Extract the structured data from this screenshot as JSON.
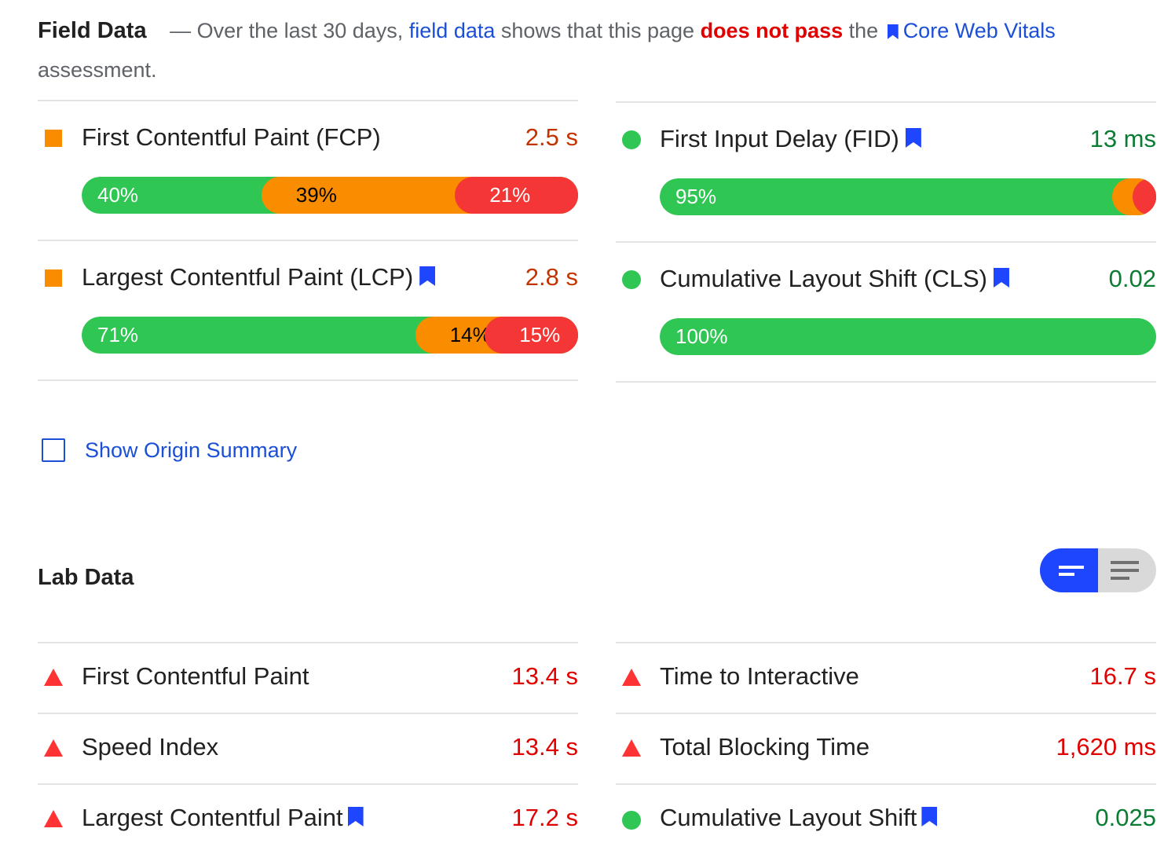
{
  "field": {
    "title": "Field Data",
    "intro_dash": "—",
    "intro_1": "Over the last 30 days,",
    "intro_link": "field data",
    "intro_2": "shows that this page",
    "intro_fail": "does not pass",
    "intro_3": "the",
    "intro_cwv": "Core Web Vitals",
    "intro_4": "assessment.",
    "metrics": [
      {
        "name": "First Contentful Paint (FCP)",
        "value": "2.5 s",
        "status": "average",
        "core": false,
        "dist": [
          40,
          39,
          21
        ],
        "labels": [
          "40%",
          "39%",
          "21%"
        ]
      },
      {
        "name": "First Input Delay (FID)",
        "value": "13 ms",
        "status": "good",
        "core": true,
        "dist": [
          95,
          4,
          1
        ],
        "labels": [
          "95%",
          "4%",
          "1%"
        ]
      },
      {
        "name": "Largest Contentful Paint (LCP)",
        "value": "2.8 s",
        "status": "average",
        "core": true,
        "dist": [
          71,
          14,
          15
        ],
        "labels": [
          "71%",
          "14%",
          "15%"
        ]
      },
      {
        "name": "Cumulative Layout Shift (CLS)",
        "value": "0.02",
        "status": "good",
        "core": true,
        "dist": [
          100,
          0,
          0
        ],
        "labels": [
          "100%",
          "",
          ""
        ]
      }
    ],
    "origin_summary_label": "Show Origin Summary",
    "origin_summary_checked": false
  },
  "lab": {
    "title": "Lab Data",
    "view_toggle": {
      "selected": "compact"
    },
    "metrics": [
      {
        "name": "First Contentful Paint",
        "value": "13.4 s",
        "status": "fail",
        "core": false
      },
      {
        "name": "Time to Interactive",
        "value": "16.7 s",
        "status": "fail",
        "core": false
      },
      {
        "name": "Speed Index",
        "value": "13.4 s",
        "status": "fail",
        "core": false
      },
      {
        "name": "Total Blocking Time",
        "value": "1,620 ms",
        "status": "fail",
        "core": false
      },
      {
        "name": "Largest Contentful Paint",
        "value": "17.2 s",
        "status": "fail",
        "core": true
      },
      {
        "name": "Cumulative Layout Shift",
        "value": "0.025",
        "status": "pass",
        "core": true
      }
    ]
  },
  "colors": {
    "good": "#2fc653",
    "average": "#fa8c00",
    "poor": "#f53636",
    "accent": "#1e46ff",
    "link": "#1a4fd6",
    "average_text": "#c33300",
    "good_text": "#0a7d32",
    "fail_text": "#e00000"
  }
}
